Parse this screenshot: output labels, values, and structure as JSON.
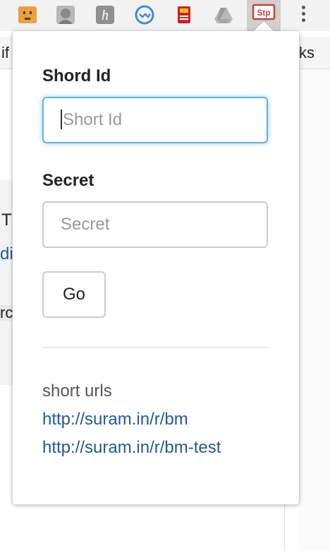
{
  "toolbar": {
    "extensions": [
      {
        "icon": "face-extension-icon",
        "color": "#e9a040"
      },
      {
        "icon": "avatar-extension-icon",
        "color": "#9a9a9a"
      },
      {
        "icon": "h-extension-icon",
        "color": "#8f8f8f"
      },
      {
        "icon": "sync-extension-icon",
        "color": "#3c8de0"
      },
      {
        "icon": "sd-card-extension-icon",
        "color": "#cc2222"
      },
      {
        "icon": "drive-extension-icon",
        "color": "#b0b0b0"
      },
      {
        "icon": "stp-extension-icon",
        "color": "#d43a3a",
        "label": "Stp",
        "active": true
      }
    ],
    "menu_icon": "kebab-menu-icon"
  },
  "background": {
    "bookmarks_left": "if",
    "bookmarks_right": "ks",
    "left_text_1": "T",
    "left_text_2": "di",
    "left_text_3": "rc"
  },
  "popup": {
    "short_id": {
      "label": "Shord Id",
      "placeholder": "Short Id",
      "value": ""
    },
    "secret": {
      "label": "Secret",
      "placeholder": "Secret",
      "value": ""
    },
    "go_label": "Go",
    "short_urls": {
      "title": "short urls",
      "links": [
        "http://suram.in/r/bm",
        "http://suram.in/r/bm-test"
      ]
    }
  },
  "colors": {
    "link": "#23599c",
    "focus": "#66afe9"
  }
}
